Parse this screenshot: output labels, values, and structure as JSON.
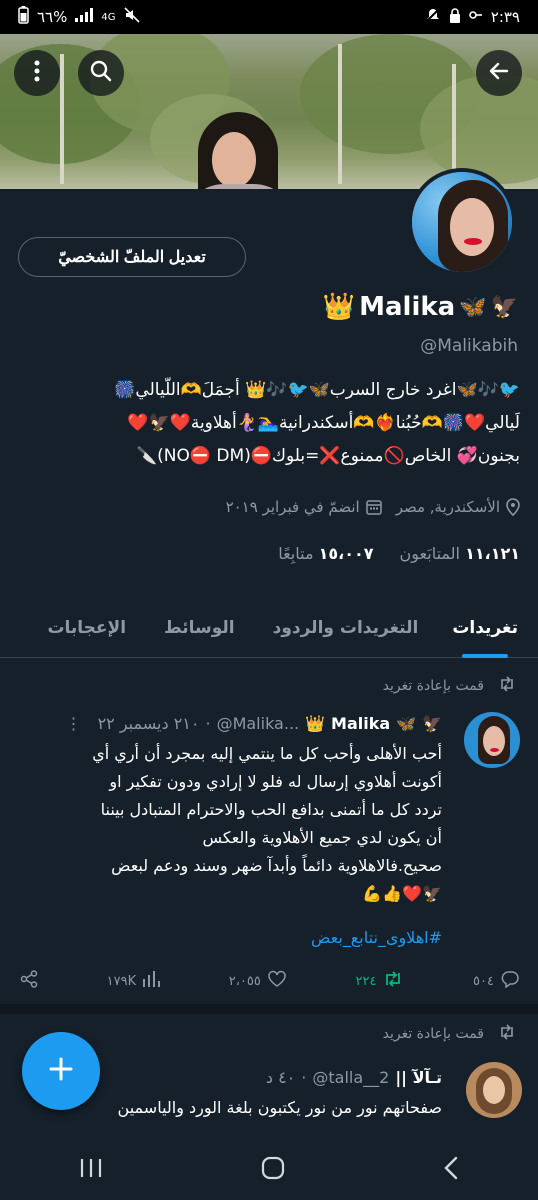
{
  "status_bar": {
    "time": "٢:٣٩",
    "battery": "٦٦%",
    "network": "4G"
  },
  "profile": {
    "name": "Malika",
    "handle": "@Malikabih",
    "edit_button": "تعديل الملفّ الشخصيّ",
    "bio_lines": [
      "🐦🎶🦋اغرد خارج السرب🦋🐦🎶👑 أجمَلَ🫶اللّيالي🎆",
      "لَيالي❤️🎆🫶حُبُنا❤️‍🔥🫶أسكندرانية🏊‍♀️🧜‍♀️أهلاوية❤️🦅❤️",
      "بجنون💞 الخاص🚫ممنوع❌=بلوك⛔(NO⛔ DM)🔪"
    ],
    "location": "الأسكندرية, مصر",
    "joined": "انضمّ في فبراير ٢٠١٩",
    "followers_count": "١١،١٢١",
    "followers_label": "المتابَعون",
    "following_count": "١٥،٠٠٧",
    "following_label": "متابِعًا"
  },
  "tabs": [
    "تغريدات",
    "التغريدات والردود",
    "الوسائط",
    "الإعجابات"
  ],
  "tweets": [
    {
      "retweet_label": "قمت بإعادة تغريد",
      "author": "Malika",
      "handle": "@Malika...",
      "time": "٢١٠ ديسمبر ٢٢",
      "lines": [
        "أحب الأهلى وأحب كل ما ينتمي إليه بمجرد أن أري أي",
        "أكونت أهلاوي إرسال له فلو لا إرادي ودون تفكير او",
        "تردد كل ما أتمنى بدافع الحب والاحترام المتبادل بيننا",
        "أن يكون لدي جميع الأهلاوية والعكس",
        "صحيح.فالاهلاوية دائماً وأبدآ ضهر وسند ودعم لبعض",
        "🦅❤️👍💪"
      ],
      "hashtag": "#اهلاوى_نتابع_بعض",
      "replies": "٥٠٤",
      "retweets": "٢٢٤",
      "likes": "٢،٠٥٥",
      "views": "١٧٩K"
    },
    {
      "retweet_label": "قمت بإعادة تغريد",
      "author": "|| تـآلآ",
      "handle": "@talla__2",
      "time": "٤٠ د",
      "lines": [
        "صفحاتهم نور من نور يكتبون بلغة الورد والياسمين"
      ]
    }
  ],
  "colors": {
    "background": "#15202b",
    "accent": "#1d9bf0",
    "muted": "#8b98a5",
    "retweet_green": "#00ba7c"
  }
}
